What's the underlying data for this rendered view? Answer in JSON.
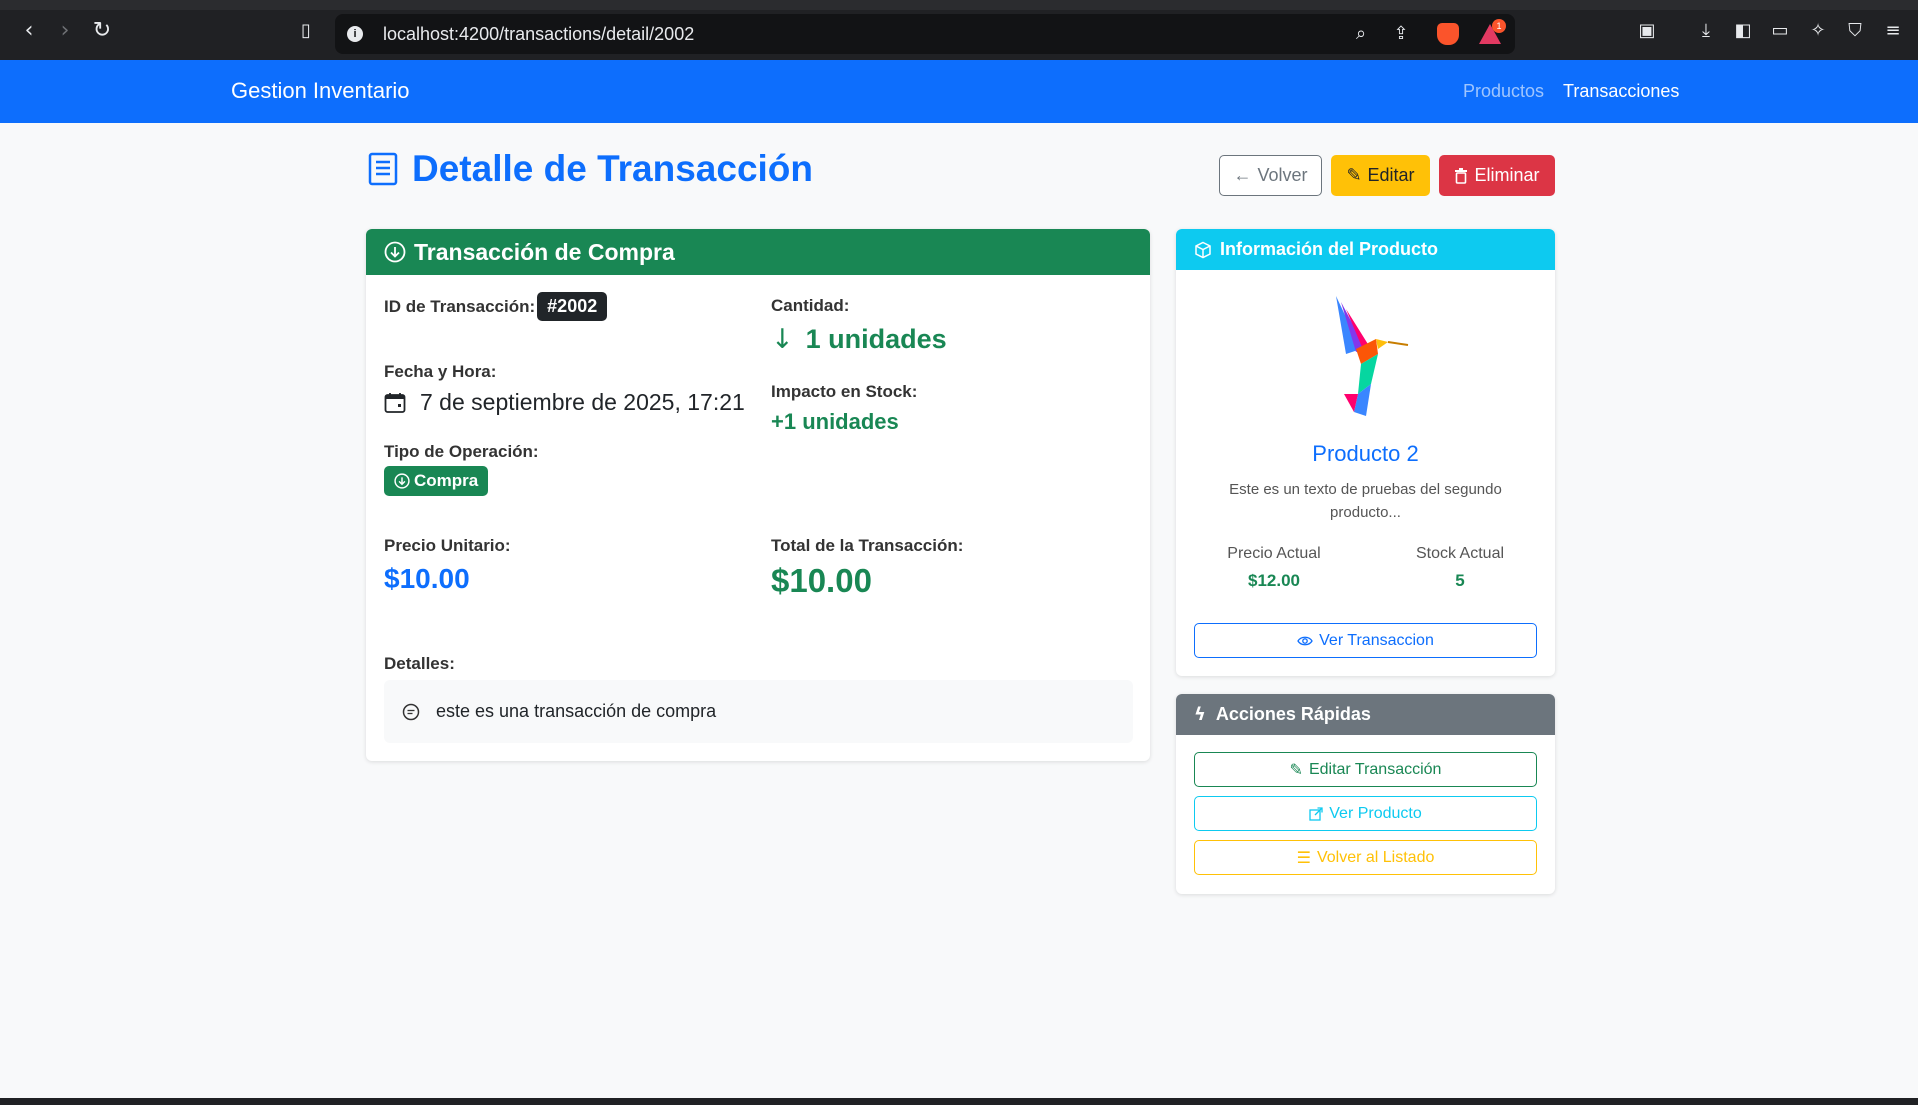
{
  "browser": {
    "url": "localhost:4200/transactions/detail/2002",
    "alert_count": "1"
  },
  "navbar": {
    "brand": "Gestion Inventario",
    "links": [
      "Productos",
      "Transacciones"
    ]
  },
  "header": {
    "title": "Detalle de Transacción",
    "buttons": {
      "back": "Volver",
      "edit": "Editar",
      "delete": "Eliminar"
    }
  },
  "transaction": {
    "card_title": "Transacción de Compra",
    "id_label": "ID de Transacción:",
    "id_value": "#2002",
    "date_label": "Fecha y Hora:",
    "date_value": "7 de septiembre de 2025, 17:21",
    "type_label": "Tipo de Operación:",
    "type_value": "Compra",
    "quantity_label": "Cantidad:",
    "quantity_value": "1 unidades",
    "stock_impact_label": "Impacto en Stock:",
    "stock_impact_value": "+1 unidades",
    "unit_price_label": "Precio Unitario:",
    "unit_price_value": "$10.00",
    "total_label": "Total de la Transacción:",
    "total_value": "$10.00",
    "details_label": "Detalles:",
    "details_value": "este es una transacción de compra"
  },
  "product": {
    "card_title": "Información del Producto",
    "name": "Producto 2",
    "description": "Este es un texto de pruebas del segundo producto...",
    "price_label": "Precio Actual",
    "price_value": "$12.00",
    "stock_label": "Stock Actual",
    "stock_value": "5",
    "view_button": "Ver Transaccion"
  },
  "quick_actions": {
    "card_title": "Acciones Rápidas",
    "edit": "Editar Transacción",
    "view_product": "Ver Producto",
    "back_to_list": "Volver al Listado"
  },
  "colors": {
    "primary": "#0d6efd",
    "success": "#198754",
    "warning": "#ffc107",
    "danger": "#dc3545",
    "info": "#0dcaf0",
    "secondary": "#6c757d"
  }
}
